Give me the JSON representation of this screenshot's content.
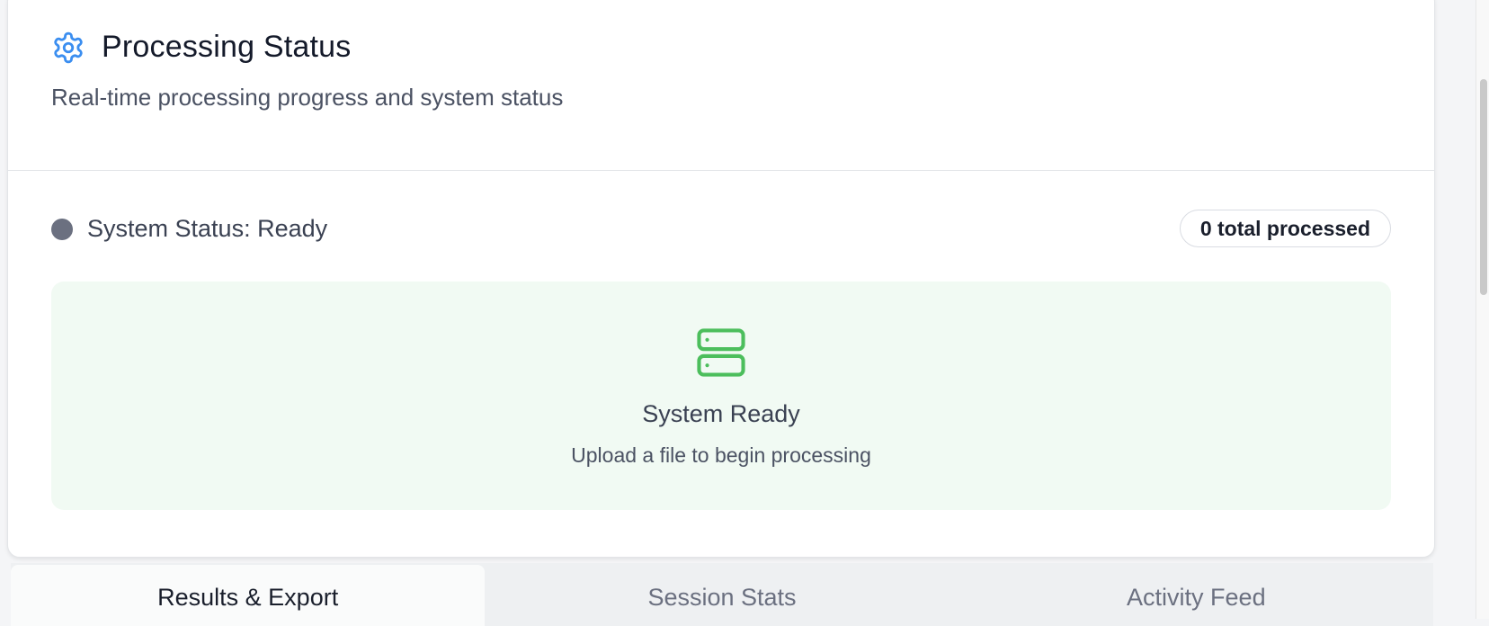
{
  "panel": {
    "title": "Processing Status",
    "subtitle": "Real-time processing progress and system status",
    "icon": "gear-icon",
    "accent_color": "#3b8ef0"
  },
  "status": {
    "label": "System Status: Ready",
    "dot_color": "#6b7080",
    "badge": "0 total processed"
  },
  "ready": {
    "icon": "server-icon",
    "icon_color": "#4cbe5c",
    "title": "System Ready",
    "message": "Upload a file to begin processing",
    "background": "#f1faf3"
  },
  "tabs": [
    {
      "label": "Results & Export",
      "active": true
    },
    {
      "label": "Session Stats",
      "active": false
    },
    {
      "label": "Activity Feed",
      "active": false
    }
  ]
}
